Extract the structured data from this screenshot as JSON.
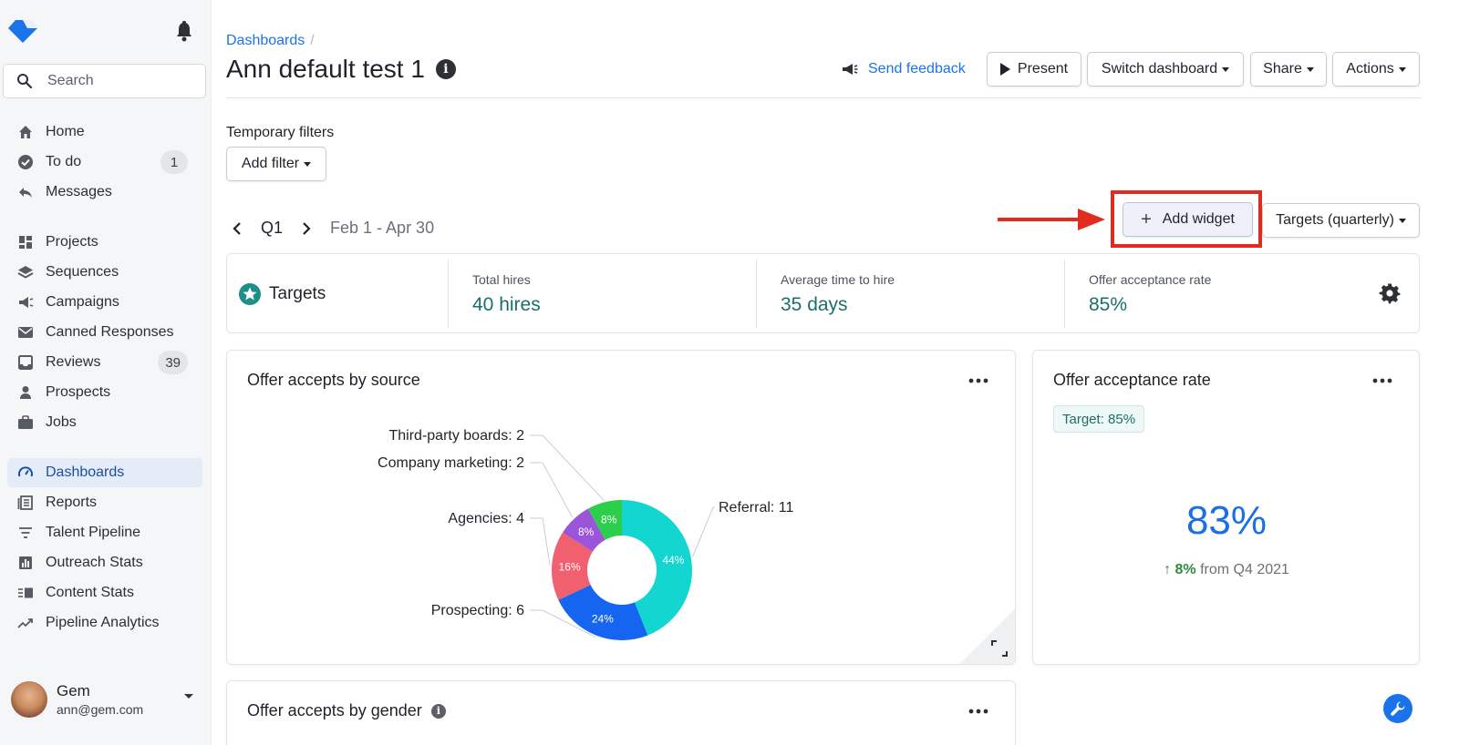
{
  "sidebar": {
    "search_placeholder": "Search",
    "items": [
      {
        "label": "Home",
        "icon": "home-icon"
      },
      {
        "label": "To do",
        "icon": "check-circle-icon",
        "badge": "1"
      },
      {
        "label": "Messages",
        "icon": "reply-icon"
      },
      {
        "label": "Projects",
        "icon": "grid-icon"
      },
      {
        "label": "Sequences",
        "icon": "layers-icon"
      },
      {
        "label": "Campaigns",
        "icon": "megaphone-icon"
      },
      {
        "label": "Canned Responses",
        "icon": "envelope-icon"
      },
      {
        "label": "Reviews",
        "icon": "inbox-icon",
        "badge": "39"
      },
      {
        "label": "Prospects",
        "icon": "person-icon"
      },
      {
        "label": "Jobs",
        "icon": "briefcase-icon"
      },
      {
        "label": "Dashboards",
        "icon": "gauge-icon",
        "active": true
      },
      {
        "label": "Reports",
        "icon": "report-icon"
      },
      {
        "label": "Talent Pipeline",
        "icon": "filter-icon"
      },
      {
        "label": "Outreach Stats",
        "icon": "bar-chart-icon"
      },
      {
        "label": "Content Stats",
        "icon": "content-icon"
      },
      {
        "label": "Pipeline Analytics",
        "icon": "trend-icon"
      }
    ],
    "user": {
      "name": "Gem",
      "email": "ann@gem.com"
    }
  },
  "header": {
    "breadcrumb": "Dashboards",
    "breadcrumb_sep": "/",
    "title": "Ann default test 1",
    "send_feedback": "Send feedback",
    "present": "Present",
    "switch_dashboard": "Switch dashboard",
    "share": "Share",
    "actions": "Actions"
  },
  "filters": {
    "label": "Temporary filters",
    "add_filter": "Add filter"
  },
  "period": {
    "quarter": "Q1",
    "range": "Feb 1 - Apr 30"
  },
  "toolbar": {
    "add_widget": "Add widget",
    "targets_select": "Targets (quarterly)"
  },
  "targets": {
    "title": "Targets",
    "metrics": [
      {
        "label": "Total hires",
        "value": "40 hires"
      },
      {
        "label": "Average time to hire",
        "value": "35 days"
      },
      {
        "label": "Offer acceptance rate",
        "value": "85%"
      }
    ]
  },
  "widgets": {
    "source_title": "Offer accepts by source",
    "rate_title": "Offer acceptance rate",
    "rate_target": "Target: 85%",
    "rate_value": "83%",
    "rate_delta": "8%",
    "rate_delta_suffix": "from Q4 2021",
    "gender_title": "Offer accepts by gender"
  },
  "chart_data": {
    "type": "pie",
    "title": "Offer accepts by source",
    "slices": [
      {
        "name": "Referral",
        "value": 11,
        "percent": "44%",
        "label": "Referral: 11",
        "color": "#14d6d1"
      },
      {
        "name": "Prospecting",
        "value": 6,
        "percent": "24%",
        "label": "Prospecting: 6",
        "color": "#1665f0"
      },
      {
        "name": "Agencies",
        "value": 4,
        "percent": "16%",
        "label": "Agencies: 4",
        "color": "#f0606e"
      },
      {
        "name": "Company marketing",
        "value": 2,
        "percent": "8%",
        "label": "Company marketing: 2",
        "color": "#9b55d9"
      },
      {
        "name": "Third-party boards",
        "value": 2,
        "percent": "8%",
        "label": "Third-party boards: 2",
        "color": "#2ccf4c"
      }
    ]
  },
  "colors": {
    "accent": "#1a73e8",
    "teal": "#1b6f6b",
    "highlight": "#e02b20"
  }
}
